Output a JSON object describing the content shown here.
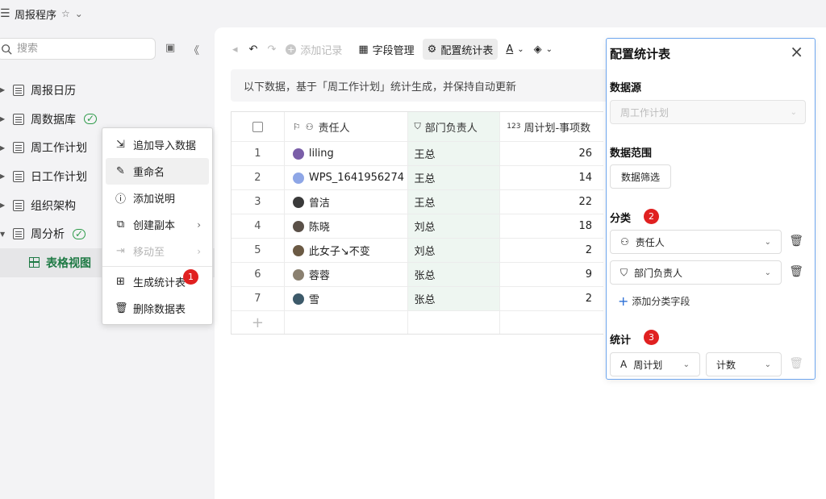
{
  "titlebar": {
    "title": "周报程序"
  },
  "sidebar": {
    "search_placeholder": "搜索",
    "items": [
      {
        "label": "周报日历"
      },
      {
        "label": "周数据库"
      },
      {
        "label": "周工作计划"
      },
      {
        "label": "日工作计划"
      },
      {
        "label": "组织架构"
      },
      {
        "label": "周分析"
      }
    ],
    "sub_item": {
      "label": "表格视图"
    }
  },
  "context_menu": {
    "items": [
      {
        "label": "追加导入数据"
      },
      {
        "label": "重命名"
      },
      {
        "label": "添加说明"
      },
      {
        "label": "创建副本"
      },
      {
        "label": "移动至"
      },
      {
        "label": "生成统计表"
      },
      {
        "label": "删除数据表"
      }
    ],
    "badge": "1"
  },
  "toolbar": {
    "add_record": "添加记录",
    "field_manage": "字段管理",
    "config_stats": "配置统计表"
  },
  "notice": "以下数据，基于「周工作计划」统计生成，并保持自动更新",
  "table": {
    "headers": [
      "责任人",
      "部门负责人",
      "周计划-事项数"
    ],
    "rows": [
      {
        "idx": "1",
        "name": "liling",
        "dept": "王总",
        "count": "26"
      },
      {
        "idx": "2",
        "name": "WPS_1641956274",
        "dept": "王总",
        "count": "14"
      },
      {
        "idx": "3",
        "name": "曾洁",
        "dept": "王总",
        "count": "22"
      },
      {
        "idx": "4",
        "name": "陈晓",
        "dept": "刘总",
        "count": "18"
      },
      {
        "idx": "5",
        "name": "此女子↘不变",
        "dept": "刘总",
        "count": "2"
      },
      {
        "idx": "6",
        "name": "蓉蓉",
        "dept": "张总",
        "count": "9"
      },
      {
        "idx": "7",
        "name": "雪",
        "dept": "张总",
        "count": "2"
      }
    ]
  },
  "config": {
    "title": "配置统计表",
    "source_label": "数据源",
    "source_value": "周工作计划",
    "range_label": "数据范围",
    "filter_button": "数据筛选",
    "category_label": "分类",
    "category_badge": "2",
    "category_fields": [
      "责任人",
      "部门负责人"
    ],
    "add_category": "添加分类字段",
    "stats_label": "统计",
    "stats_badge": "3",
    "stats_field": "周计划",
    "stats_method": "计数"
  }
}
